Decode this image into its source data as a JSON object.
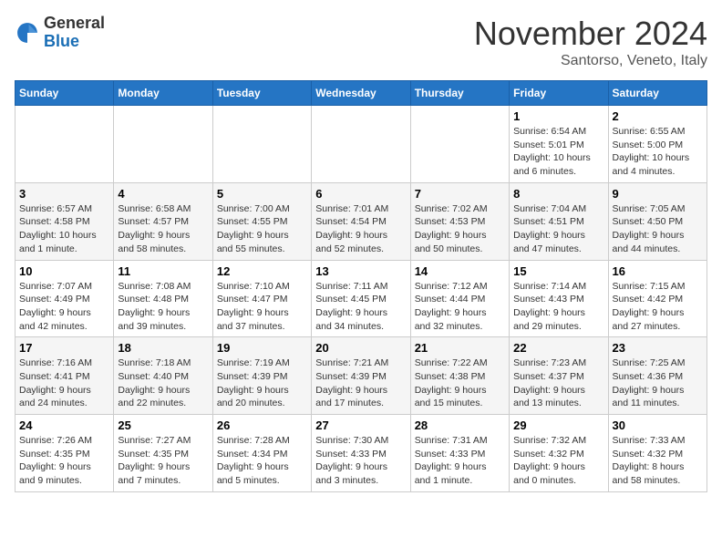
{
  "header": {
    "logo": {
      "line1": "General",
      "line2": "Blue"
    },
    "month": "November 2024",
    "location": "Santorso, Veneto, Italy"
  },
  "weekdays": [
    "Sunday",
    "Monday",
    "Tuesday",
    "Wednesday",
    "Thursday",
    "Friday",
    "Saturday"
  ],
  "weeks": [
    [
      {
        "day": "",
        "info": ""
      },
      {
        "day": "",
        "info": ""
      },
      {
        "day": "",
        "info": ""
      },
      {
        "day": "",
        "info": ""
      },
      {
        "day": "",
        "info": ""
      },
      {
        "day": "1",
        "info": "Sunrise: 6:54 AM\nSunset: 5:01 PM\nDaylight: 10 hours\nand 6 minutes."
      },
      {
        "day": "2",
        "info": "Sunrise: 6:55 AM\nSunset: 5:00 PM\nDaylight: 10 hours\nand 4 minutes."
      }
    ],
    [
      {
        "day": "3",
        "info": "Sunrise: 6:57 AM\nSunset: 4:58 PM\nDaylight: 10 hours\nand 1 minute."
      },
      {
        "day": "4",
        "info": "Sunrise: 6:58 AM\nSunset: 4:57 PM\nDaylight: 9 hours\nand 58 minutes."
      },
      {
        "day": "5",
        "info": "Sunrise: 7:00 AM\nSunset: 4:55 PM\nDaylight: 9 hours\nand 55 minutes."
      },
      {
        "day": "6",
        "info": "Sunrise: 7:01 AM\nSunset: 4:54 PM\nDaylight: 9 hours\nand 52 minutes."
      },
      {
        "day": "7",
        "info": "Sunrise: 7:02 AM\nSunset: 4:53 PM\nDaylight: 9 hours\nand 50 minutes."
      },
      {
        "day": "8",
        "info": "Sunrise: 7:04 AM\nSunset: 4:51 PM\nDaylight: 9 hours\nand 47 minutes."
      },
      {
        "day": "9",
        "info": "Sunrise: 7:05 AM\nSunset: 4:50 PM\nDaylight: 9 hours\nand 44 minutes."
      }
    ],
    [
      {
        "day": "10",
        "info": "Sunrise: 7:07 AM\nSunset: 4:49 PM\nDaylight: 9 hours\nand 42 minutes."
      },
      {
        "day": "11",
        "info": "Sunrise: 7:08 AM\nSunset: 4:48 PM\nDaylight: 9 hours\nand 39 minutes."
      },
      {
        "day": "12",
        "info": "Sunrise: 7:10 AM\nSunset: 4:47 PM\nDaylight: 9 hours\nand 37 minutes."
      },
      {
        "day": "13",
        "info": "Sunrise: 7:11 AM\nSunset: 4:45 PM\nDaylight: 9 hours\nand 34 minutes."
      },
      {
        "day": "14",
        "info": "Sunrise: 7:12 AM\nSunset: 4:44 PM\nDaylight: 9 hours\nand 32 minutes."
      },
      {
        "day": "15",
        "info": "Sunrise: 7:14 AM\nSunset: 4:43 PM\nDaylight: 9 hours\nand 29 minutes."
      },
      {
        "day": "16",
        "info": "Sunrise: 7:15 AM\nSunset: 4:42 PM\nDaylight: 9 hours\nand 27 minutes."
      }
    ],
    [
      {
        "day": "17",
        "info": "Sunrise: 7:16 AM\nSunset: 4:41 PM\nDaylight: 9 hours\nand 24 minutes."
      },
      {
        "day": "18",
        "info": "Sunrise: 7:18 AM\nSunset: 4:40 PM\nDaylight: 9 hours\nand 22 minutes."
      },
      {
        "day": "19",
        "info": "Sunrise: 7:19 AM\nSunset: 4:39 PM\nDaylight: 9 hours\nand 20 minutes."
      },
      {
        "day": "20",
        "info": "Sunrise: 7:21 AM\nSunset: 4:39 PM\nDaylight: 9 hours\nand 17 minutes."
      },
      {
        "day": "21",
        "info": "Sunrise: 7:22 AM\nSunset: 4:38 PM\nDaylight: 9 hours\nand 15 minutes."
      },
      {
        "day": "22",
        "info": "Sunrise: 7:23 AM\nSunset: 4:37 PM\nDaylight: 9 hours\nand 13 minutes."
      },
      {
        "day": "23",
        "info": "Sunrise: 7:25 AM\nSunset: 4:36 PM\nDaylight: 9 hours\nand 11 minutes."
      }
    ],
    [
      {
        "day": "24",
        "info": "Sunrise: 7:26 AM\nSunset: 4:35 PM\nDaylight: 9 hours\nand 9 minutes."
      },
      {
        "day": "25",
        "info": "Sunrise: 7:27 AM\nSunset: 4:35 PM\nDaylight: 9 hours\nand 7 minutes."
      },
      {
        "day": "26",
        "info": "Sunrise: 7:28 AM\nSunset: 4:34 PM\nDaylight: 9 hours\nand 5 minutes."
      },
      {
        "day": "27",
        "info": "Sunrise: 7:30 AM\nSunset: 4:33 PM\nDaylight: 9 hours\nand 3 minutes."
      },
      {
        "day": "28",
        "info": "Sunrise: 7:31 AM\nSunset: 4:33 PM\nDaylight: 9 hours\nand 1 minute."
      },
      {
        "day": "29",
        "info": "Sunrise: 7:32 AM\nSunset: 4:32 PM\nDaylight: 9 hours\nand 0 minutes."
      },
      {
        "day": "30",
        "info": "Sunrise: 7:33 AM\nSunset: 4:32 PM\nDaylight: 8 hours\nand 58 minutes."
      }
    ]
  ]
}
